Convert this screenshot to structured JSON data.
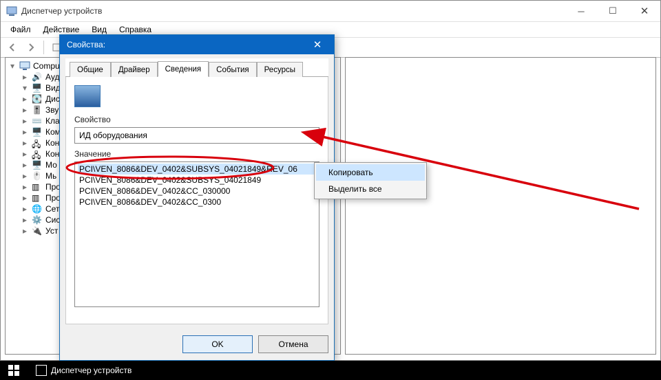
{
  "main": {
    "title": "Диспетчер устройств",
    "menu": {
      "file": "Файл",
      "action": "Действие",
      "view": "Вид",
      "help": "Справка"
    },
    "tree": {
      "root": "Compu",
      "items": [
        "Ауд",
        "Вид",
        "Дис",
        "Зву",
        "Кла",
        "Ком",
        "Кон",
        "Кон",
        "Мо",
        "Мь",
        "Про",
        "Про",
        "Сет",
        "Сис",
        "Уст"
      ]
    }
  },
  "dialog": {
    "title": "Свойства:",
    "tabs": {
      "general": "Общие",
      "driver": "Драйвер",
      "details": "Сведения",
      "events": "События",
      "resources": "Ресурсы"
    },
    "property_label": "Свойство",
    "property_selected": "ИД оборудования",
    "value_label": "Значение",
    "values": [
      "PCI\\VEN_8086&DEV_0402&SUBSYS_04021849&REV_06",
      "PCI\\VEN_8086&DEV_0402&SUBSYS_04021849",
      "PCI\\VEN_8086&DEV_0402&CC_030000",
      "PCI\\VEN_8086&DEV_0402&CC_0300"
    ],
    "ok": "OK",
    "cancel": "Отмена"
  },
  "context_menu": {
    "copy": "Копировать",
    "select_all": "Выделить все"
  },
  "taskbar": {
    "app": "Диспетчер устройств"
  }
}
